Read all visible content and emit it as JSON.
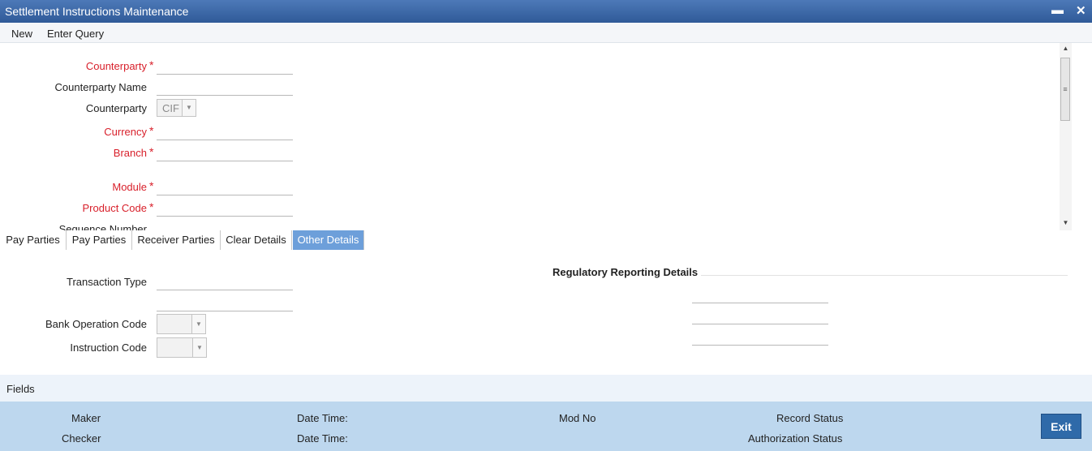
{
  "window": {
    "title": "Settlement Instructions Maintenance",
    "minimize_glyph": "▬",
    "close_glyph": "✕"
  },
  "menu": {
    "new_label": "New",
    "enter_query_label": "Enter Query"
  },
  "form": {
    "counterparty_label": "Counterparty",
    "counterparty_name_label": "Counterparty Name",
    "counterparty_type_label": "Counterparty",
    "counterparty_type_value": "CIF",
    "currency_label": "Currency",
    "branch_label": "Branch",
    "module_label": "Module",
    "product_code_label": "Product Code",
    "sequence_number_label": "Sequence Number",
    "required_marker": "*"
  },
  "tabs": [
    {
      "label": "Pay Parties",
      "active": false
    },
    {
      "label": "Pay Parties",
      "active": false
    },
    {
      "label": "Receiver Parties",
      "active": false
    },
    {
      "label": "Clear Details",
      "active": false
    },
    {
      "label": "Other Details",
      "active": true
    }
  ],
  "other_details": {
    "transaction_type_label": "Transaction Type",
    "bank_operation_code_label": "Bank Operation Code",
    "instruction_code_label": "Instruction Code",
    "regulatory_header": "Regulatory Reporting Details"
  },
  "fields_bar": {
    "label": "Fields"
  },
  "footer": {
    "maker_label": "Maker",
    "checker_label": "Checker",
    "date_time_label_1": "Date Time:",
    "date_time_label_2": "Date Time:",
    "mod_no_label": "Mod No",
    "record_status_label": "Record Status",
    "authorization_status_label": "Authorization Status",
    "exit_label": "Exit"
  },
  "colors": {
    "title_bar": "#2f5a98",
    "required": "#d81f2a",
    "active_tab": "#6d9fda",
    "footer": "#bdd7ee",
    "exit_button": "#2f6aa9"
  }
}
